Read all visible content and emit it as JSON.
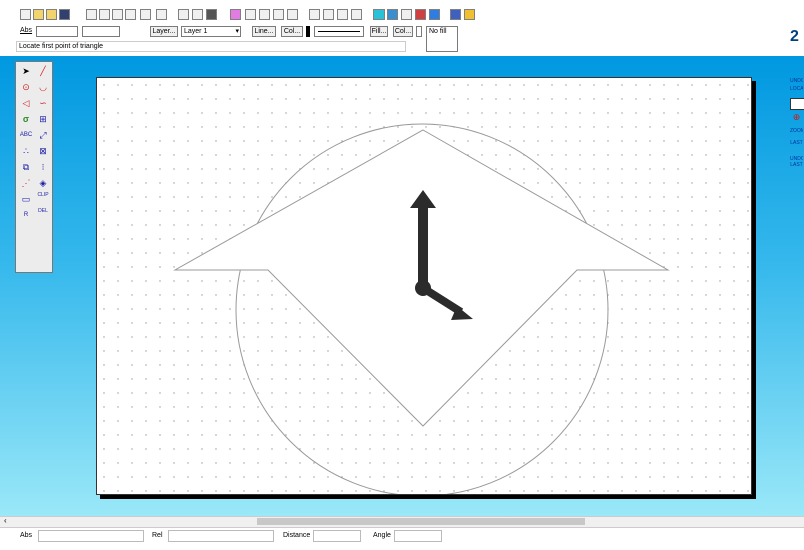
{
  "toolbar": {
    "icons": [
      "new-icon",
      "open-icon",
      "open-folder-icon",
      "save-icon",
      "print-setup-icon",
      "print-icon",
      "copy-icon",
      "paste-icon",
      "text-size-icon",
      "undo-icon",
      "cut-icon",
      "copy2-icon",
      "paste2-icon",
      "select-icon",
      "align-left-icon",
      "align-center-icon",
      "align-right-icon",
      "layer-front-icon",
      "layer-back-icon",
      "group-icon",
      "ungroup-icon",
      "frame-icon",
      "corner-icon",
      "pen-icon",
      "printer-icon",
      "color-icon",
      "help-icon",
      "info-icon"
    ]
  },
  "props": {
    "abs_label": "Abs",
    "layer_button": "Layer...",
    "layer_value": "Layer 1",
    "line_button": "Line...",
    "col_button": "Col...",
    "fill_button": "Fill...",
    "col2_button": "Col...",
    "fill_value": "No fill",
    "prompt": "Locate first point of triangle"
  },
  "tools": [
    "pointer",
    "line",
    "circle",
    "arc",
    "triangle",
    "curve",
    "spiral",
    "perspective",
    "text",
    "dimension",
    "node",
    "shape",
    "frame",
    "layers",
    "insert",
    "eraser",
    "rectangle",
    "clip",
    "rotate",
    "delete"
  ],
  "tool_labels": {
    "text": "ABC",
    "clip": "CLIP",
    "delete": "DEL",
    "rotate": "R"
  },
  "right_panel": {
    "brand": "2",
    "labels": [
      "UNDO",
      "LOCATE",
      "ZOOM",
      "LAST",
      "UNDO LAST"
    ]
  },
  "status": {
    "abs_label": "Abs",
    "rel_label": "Rel",
    "distance_label": "Distance",
    "angle_label": "Angle"
  },
  "colors": {
    "workspace_top": "#0098e0",
    "workspace_bottom": "#9ae8f8",
    "clock_hands": "#2b2b2b",
    "outline": "#999999"
  }
}
